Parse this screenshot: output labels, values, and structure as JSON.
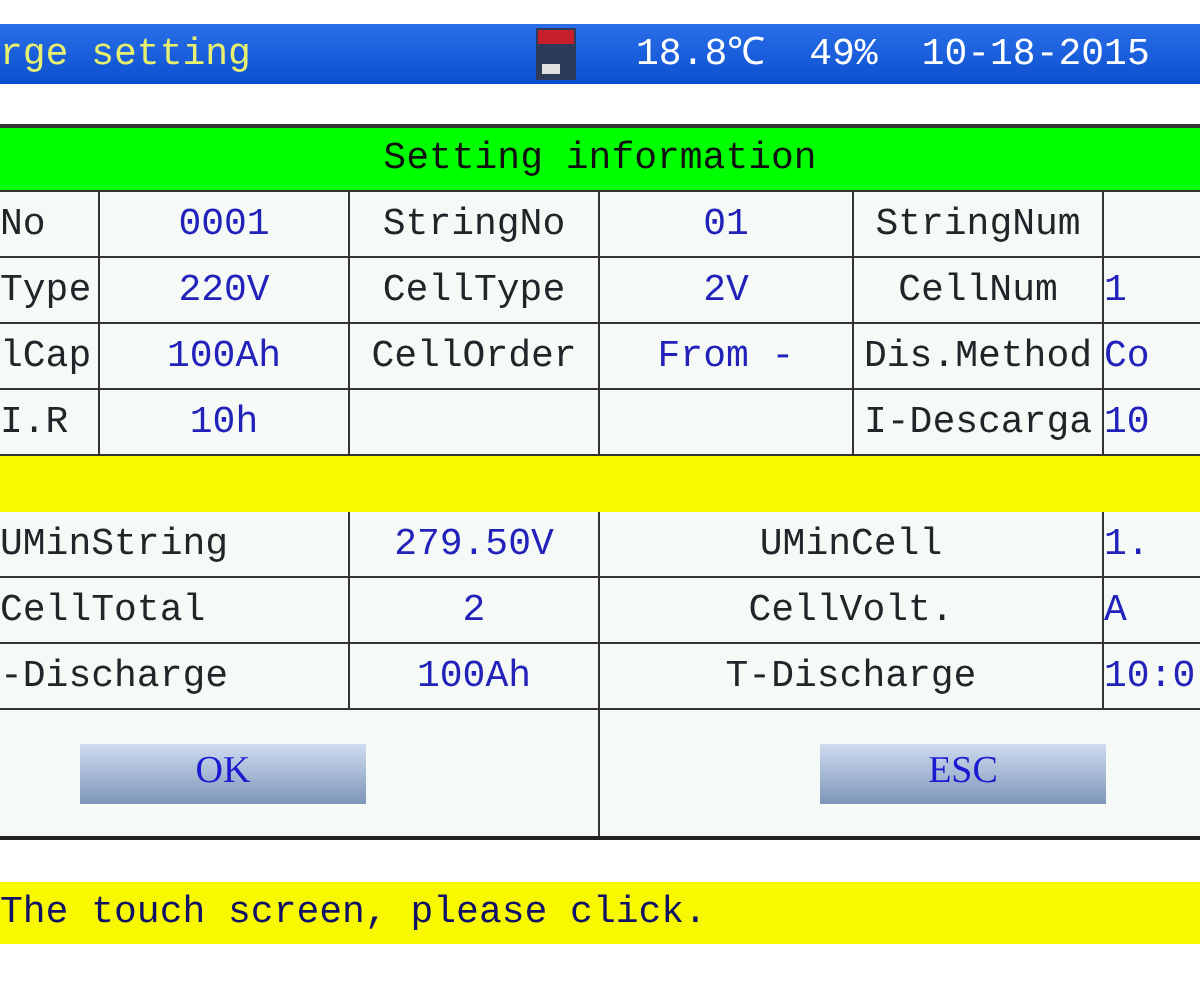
{
  "header": {
    "title": "rge setting",
    "temperature": "18.8℃",
    "humidity": "49%",
    "date": "10-18-2015"
  },
  "section_title": "Setting information",
  "settings": [
    [
      {
        "kind": "label",
        "text": "No"
      },
      {
        "kind": "value",
        "text": "0001"
      },
      {
        "kind": "label",
        "text": "StringNo"
      },
      {
        "kind": "value",
        "text": "01"
      },
      {
        "kind": "label",
        "text": "StringNum"
      },
      {
        "kind": "empty"
      }
    ],
    [
      {
        "kind": "label",
        "text": "Type"
      },
      {
        "kind": "value",
        "text": "220V"
      },
      {
        "kind": "label",
        "text": "CellType"
      },
      {
        "kind": "value",
        "text": "2V"
      },
      {
        "kind": "label",
        "text": "CellNum"
      },
      {
        "kind": "value",
        "text": "1"
      }
    ],
    [
      {
        "kind": "label",
        "text": "lCap"
      },
      {
        "kind": "value",
        "text": "100Ah"
      },
      {
        "kind": "label",
        "text": "CellOrder"
      },
      {
        "kind": "value",
        "text": "From -"
      },
      {
        "kind": "label",
        "text": "Dis.Method"
      },
      {
        "kind": "value",
        "text": "Co"
      }
    ],
    [
      {
        "kind": "label",
        "text": "I.R"
      },
      {
        "kind": "value",
        "text": "10h"
      },
      {
        "kind": "empty"
      },
      {
        "kind": "empty"
      },
      {
        "kind": "label",
        "text": "I-Descarga"
      },
      {
        "kind": "value",
        "text": "10"
      }
    ]
  ],
  "results": [
    [
      {
        "kind": "label",
        "text": "UMinString"
      },
      {
        "kind": "value",
        "text": "279.50V"
      },
      {
        "kind": "label",
        "text": "UMinCell"
      },
      {
        "kind": "value",
        "text": "1."
      }
    ],
    [
      {
        "kind": "label",
        "text": "CellTotal"
      },
      {
        "kind": "value",
        "text": "2"
      },
      {
        "kind": "label",
        "text": "CellVolt."
      },
      {
        "kind": "value",
        "text": "A"
      }
    ],
    [
      {
        "kind": "label",
        "text": "-Discharge"
      },
      {
        "kind": "value",
        "text": "100Ah"
      },
      {
        "kind": "label",
        "text": "T-Discharge"
      },
      {
        "kind": "value",
        "text": "10:0"
      }
    ]
  ],
  "buttons": [
    "OK",
    "ESC"
  ],
  "status_bar": "The touch screen, please click."
}
